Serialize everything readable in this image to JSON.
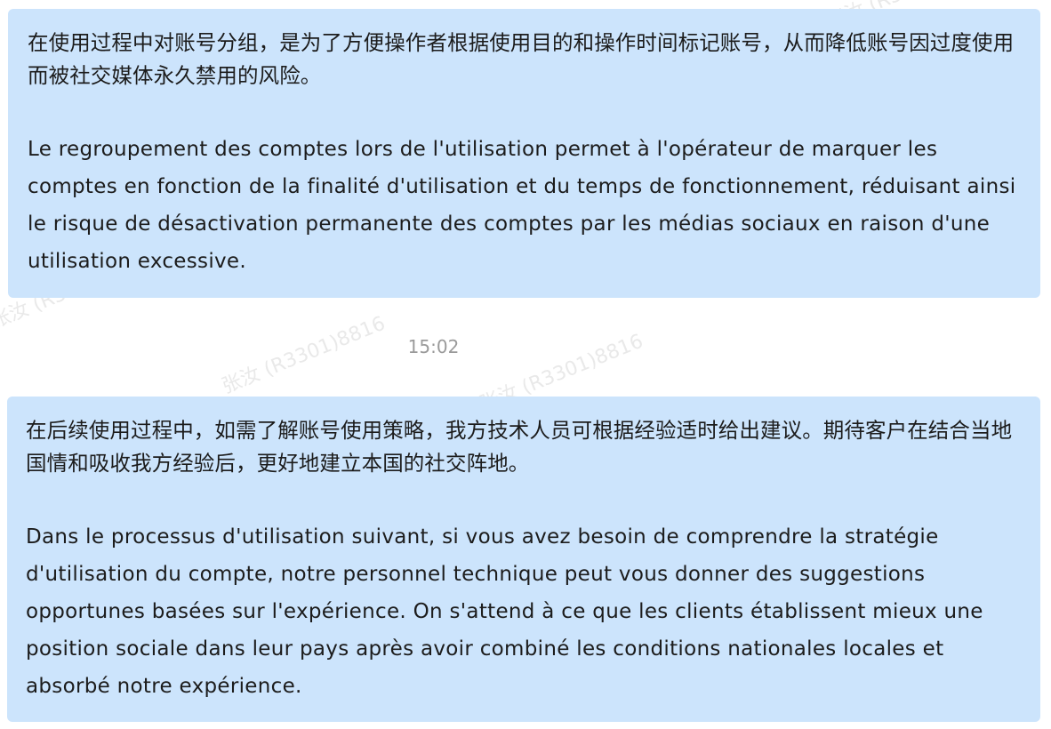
{
  "watermark": {
    "text": "张汝 (R3301)8816"
  },
  "messages": [
    {
      "zh": "在使用过程中对账号分组，是为了方便操作者根据使用目的和操作时间标记账号，从而降低账号因过度使用而被社交媒体永久禁用的风险。",
      "fr": "Le regroupement des comptes lors de l'utilisation permet à l'opérateur de marquer les comptes en fonction de la finalité d'utilisation et du temps de fonctionnement, réduisant ainsi le risque de désactivation permanente des comptes par les médias sociaux en raison d'une utilisation excessive."
    },
    {
      "zh": "在后续使用过程中，如需了解账号使用策略，我方技术人员可根据经验适时给出建议。期待客户在结合当地国情和吸收我方经验后，更好地建立本国的社交阵地。",
      "fr": "Dans le processus d'utilisation suivant, si vous avez besoin de comprendre la stratégie d'utilisation du compte, notre personnel technique peut vous donner des suggestions opportunes basées sur l'expérience. On s'attend à ce que les clients établissent mieux une position sociale dans leur pays après avoir combiné les conditions nationales locales et absorbé notre expérience."
    }
  ],
  "timestamp": "15:02",
  "colors": {
    "bubble": "#cce4fc",
    "timestamp": "#9a9a9a",
    "background": "#ffffff"
  }
}
